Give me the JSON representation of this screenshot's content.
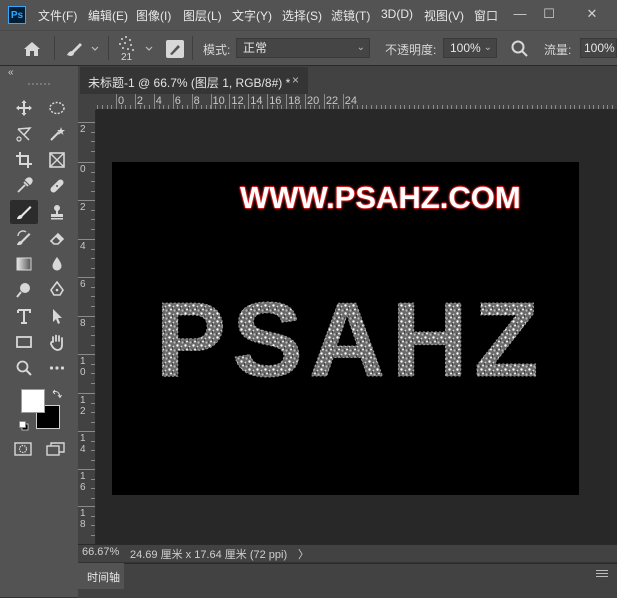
{
  "app": {
    "logo": "Ps"
  },
  "menu": {
    "items": [
      "文件(F)",
      "编辑(E)",
      "图像(I)",
      "图层(L)",
      "文字(Y)",
      "选择(S)",
      "滤镜(T)",
      "3D(D)",
      "视图(V)",
      "窗口"
    ]
  },
  "window_controls": {
    "minimize": "—",
    "maximize": "☐",
    "close": "✕"
  },
  "options": {
    "brush_size": "21",
    "mode_label": "模式:",
    "mode_value": "正常",
    "opacity_label": "不透明度:",
    "opacity_value": "100%",
    "flow_label": "流量:",
    "flow_value": "100%"
  },
  "toolbox": {
    "collapse_glyph": "«"
  },
  "document": {
    "tab_title": "未标题-1 @ 66.7% (图层 1, RGB/8#) *",
    "close_glyph": "×"
  },
  "rulers": {
    "top_labels": [
      "0",
      "2",
      "4",
      "6",
      "8",
      "10",
      "12",
      "14",
      "16",
      "18",
      "20",
      "22",
      "24"
    ],
    "left_labels": [
      "2",
      "0",
      "2",
      "4",
      "6",
      "8",
      "1 0",
      "1 2",
      "1 4",
      "1 6",
      "1 8"
    ]
  },
  "canvas": {
    "url_text": "WWW.PSAHZ.COM",
    "big_text": "PSAHZ"
  },
  "status": {
    "zoom": "66.67%",
    "doc_size": "24.69 厘米 x 17.64 厘米 (72 ppi)",
    "arrow": "〉"
  },
  "timeline": {
    "label": "时间轴"
  },
  "colors": {
    "foreground": "#ffffff",
    "background": "#000000",
    "url_glow": "#c41818",
    "ui_panel": "#535353"
  },
  "icons": {
    "toolbox": [
      "move-icon",
      "marquee-icon",
      "lasso-icon",
      "magic-wand-icon",
      "crop-icon",
      "frame-icon",
      "eyedropper-icon",
      "healing-brush-icon",
      "brush-icon",
      "stamp-icon",
      "history-brush-icon",
      "eraser-icon",
      "gradient-icon",
      "blur-icon",
      "dodge-icon",
      "pen-icon",
      "type-icon",
      "path-select-icon",
      "rectangle-icon",
      "hand-icon",
      "zoom-icon",
      "more-icon"
    ]
  }
}
